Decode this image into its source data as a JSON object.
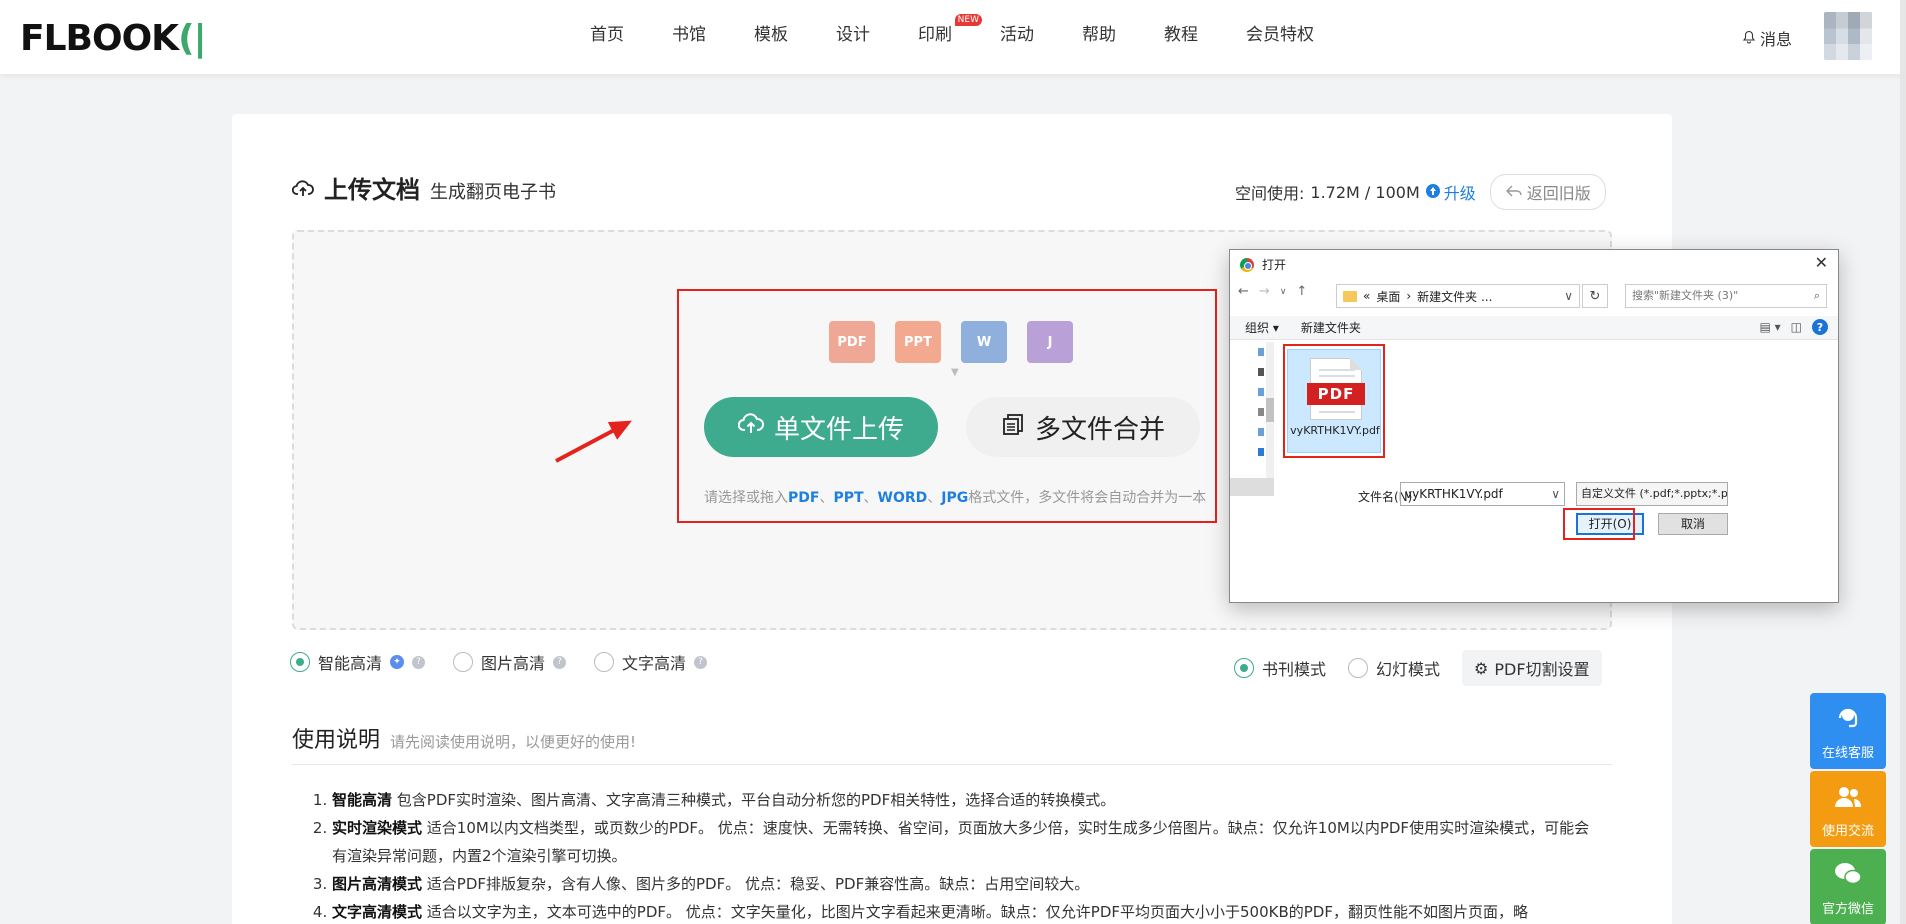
{
  "header": {
    "logo": "FLBOOK",
    "nav": [
      "首页",
      "书馆",
      "模板",
      "设计",
      "印刷",
      "活动",
      "帮助",
      "教程",
      "会员特权"
    ],
    "new_badge": "NEW",
    "messages": "消息"
  },
  "upload": {
    "title": "上传文档",
    "subtitle": "生成翻页电子书",
    "space_label": "空间使用:",
    "space_value": "1.72M / 100M",
    "upgrade": "升级",
    "old_version": "返回旧版",
    "single_btn": "单文件上传",
    "multi_btn": "多文件合并",
    "hint_prefix": "请选择或拖入",
    "hint_pdf": "PDF",
    "hint_sep1": "、",
    "hint_ppt": "PPT",
    "hint_sep2": "、",
    "hint_word": "WORD",
    "hint_sep3": "、",
    "hint_jpg": "JPG",
    "hint_suffix": "格式文件，多文件将会自动合并为一本",
    "file_icons": [
      "PDF",
      "PPT",
      "W",
      "J"
    ]
  },
  "options": {
    "quality": [
      {
        "label": "智能高清",
        "selected": true
      },
      {
        "label": "图片高清",
        "selected": false
      },
      {
        "label": "文字高清",
        "selected": false
      }
    ],
    "mode": [
      {
        "label": "书刊模式",
        "selected": true
      },
      {
        "label": "幻灯模式",
        "selected": false
      }
    ],
    "pdf_split": "PDF切割设置"
  },
  "instructions": {
    "title": "使用说明",
    "subtitle": "请先阅读使用说明，以便更好的使用!",
    "items": [
      {
        "bold": "智能高清",
        "text": " 包含PDF实时渲染、图片高清、文字高清三种模式，平台自动分析您的PDF相关特性，选择合适的转换模式。"
      },
      {
        "bold": "实时渲染模式",
        "text": " 适合10M以内文档类型，或页数少的PDF。 优点：速度快、无需转换、省空间，页面放大多少倍，实时生成多少倍图片。缺点：仅允许10M以内PDF使用实时渲染模式，可能会有渲染异常问题，内置2个渲染引擎可切换。"
      },
      {
        "bold": "图片高清模式",
        "text": " 适合PDF排版复杂，含有人像、图片多的PDF。 优点：稳妥、PDF兼容性高。缺点：占用空间较大。"
      },
      {
        "bold": "文字高清模式",
        "text": " 适合以文字为主，文本可选中的PDF。 优点：文字矢量化，比图片文字看起来更清晰。缺点：仅允许PDF平均页面大小小于500KB的PDF，翻页性能不如图片页面，略"
      }
    ]
  },
  "side": {
    "service": "在线客服",
    "community": "使用交流",
    "wechat": "官方微信"
  },
  "dialog": {
    "title": "打开",
    "path_prefix": "«",
    "path_1": "桌面",
    "path_sep": "›",
    "path_2": "新建文件夹 ...",
    "search_placeholder": "搜索\"新建文件夹 (3)\"",
    "organize": "组织 ▾",
    "new_folder": "新建文件夹",
    "file_name": "vyKRTHK1VY.pdf",
    "file_badge": "PDF",
    "filename_label": "文件名(N):",
    "filename_value": "vyKRTHK1VY.pdf",
    "filetype": "自定义文件 (*.pdf;*.pptx;*.ppt",
    "open": "打开(O)",
    "cancel": "取消"
  },
  "colors": {
    "accent": "#3eab8f",
    "link": "#1e7fe0",
    "highlight": "#e3231c"
  }
}
